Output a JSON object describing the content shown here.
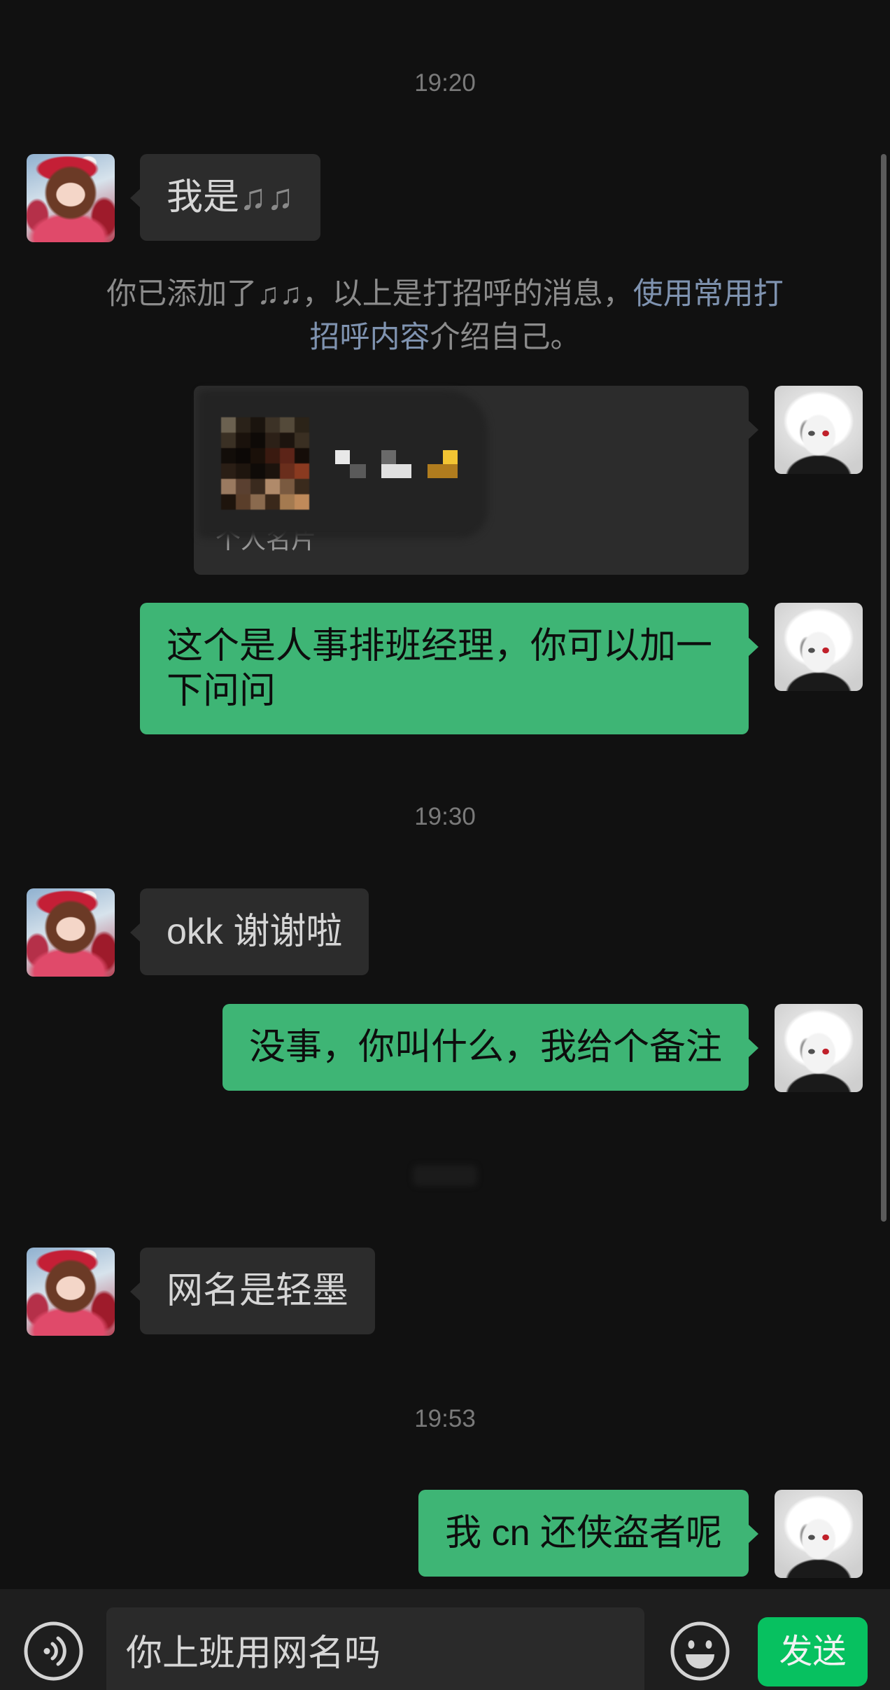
{
  "colors": {
    "chat_background": "#111111",
    "received_bubble": "#2c2c2c",
    "sent_bubble": "#3eb575",
    "send_button": "#07c160",
    "link_text": "#7f93b0",
    "timestamp_text": "#7a7a7a"
  },
  "chat": {
    "timestamps": [
      "19:20",
      "19:30",
      "19:53"
    ],
    "system_notice": {
      "text_before": "你已添加了",
      "contact_name": "♫♫",
      "text_middle": "，以上是打招呼的消息，",
      "link_line_1": "使用常用打",
      "link_line_2": "招呼内容",
      "text_after": "介绍自己。"
    },
    "messages": [
      {
        "text": "我是",
        "emoji": "♫♫"
      },
      {
        "card_label": "个人名片"
      },
      {
        "text": "这个是人事排班经理，你可以加一下问问"
      },
      {
        "text": "okk 谢谢啦"
      },
      {
        "text": "没事，你叫什么，我给个备注"
      },
      {
        "text": "网名是轻墨"
      },
      {
        "text": "我 cn 还侠盗者呢"
      }
    ]
  },
  "input_bar": {
    "draft_text": "你上班用网名吗",
    "send_label": "发送"
  },
  "icons": {
    "voice_toggle": "voice-input-icon",
    "emoji_panel": "emoji-icon"
  }
}
